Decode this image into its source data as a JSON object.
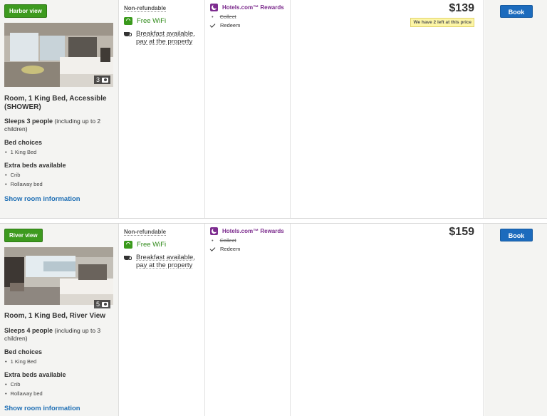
{
  "colors": {
    "accent_green": "#3d9a1f",
    "link_blue": "#1f6fb5",
    "book_blue": "#1c6bbd",
    "rewards_purple": "#7b2a8c",
    "badge_yellow": "#fdf6a6"
  },
  "rooms": [
    {
      "view_badge": "Harbor view",
      "photo_count": "3",
      "title": "Room, 1 King Bed, Accessible (SHOWER)",
      "sleeps_bold": "Sleeps 3 people",
      "sleeps_rest": " (including up to 2 children)",
      "bed_choices_label": "Bed choices",
      "bed_choices": [
        "1 King Bed"
      ],
      "extra_beds_label": "Extra beds available",
      "extra_beds": [
        "Crib",
        "Rollaway bed"
      ],
      "show_info": "Show room information",
      "policy": "Non-refundable",
      "wifi": "Free WiFi",
      "breakfast": "Breakfast available, pay at the property",
      "rewards_title": "Hotels.com™ Rewards",
      "rewards_collect": "Collect",
      "rewards_redeem": "Redeem",
      "price": "$139",
      "availability": "We have 2 left at this price",
      "book": "Book"
    },
    {
      "view_badge": "River view",
      "photo_count": "5",
      "title": "Room, 1 King Bed, River View",
      "sleeps_bold": "Sleeps 4 people",
      "sleeps_rest": " (including up to 3 children)",
      "bed_choices_label": "Bed choices",
      "bed_choices": [
        "1 King Bed"
      ],
      "extra_beds_label": "Extra beds available",
      "extra_beds": [
        "Crib",
        "Rollaway bed"
      ],
      "show_info": "Show room information",
      "policy": "Non-refundable",
      "wifi": "Free WiFi",
      "breakfast": "Breakfast available, pay at the property",
      "rewards_title": "Hotels.com™ Rewards",
      "rewards_collect": "Collect",
      "rewards_redeem": "Redeem",
      "price": "$159",
      "book": "Book"
    }
  ]
}
